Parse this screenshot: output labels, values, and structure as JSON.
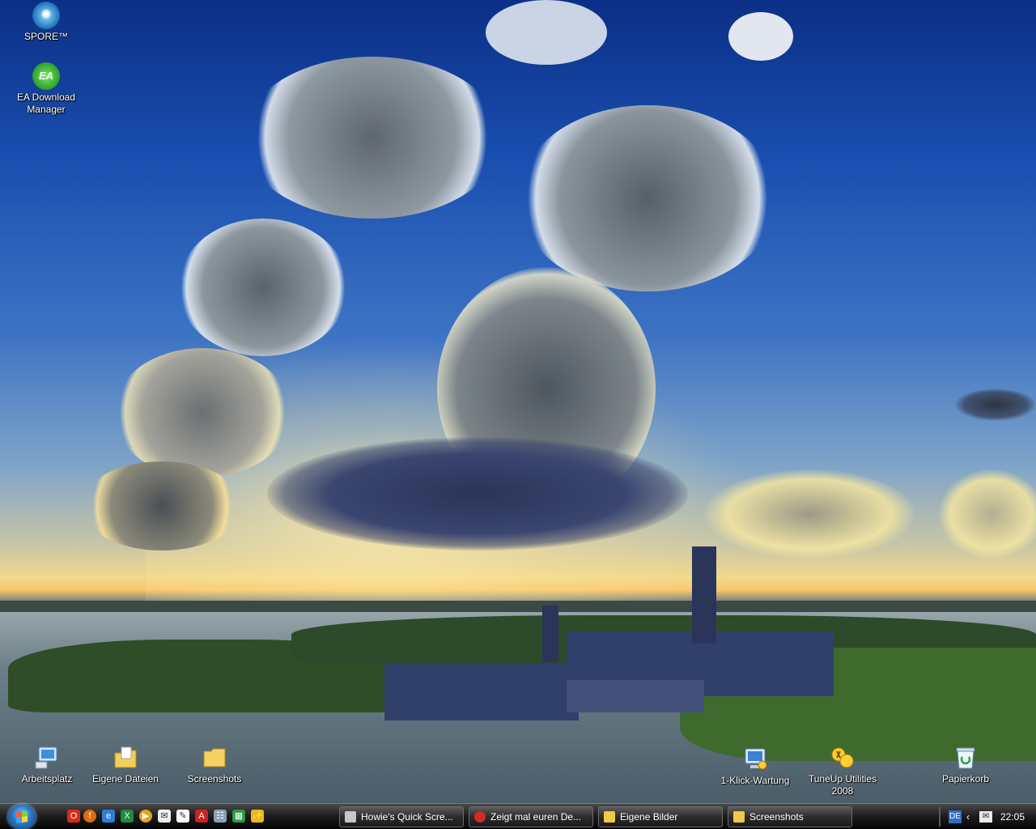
{
  "desktop": {
    "icons": [
      {
        "label": "SPORE™",
        "icon": "spore-icon"
      },
      {
        "label": "EA Download\nManager",
        "icon": "ea-icon"
      },
      {
        "label": "Arbeitsplatz",
        "icon": "computer-icon"
      },
      {
        "label": "Eigene Dateien",
        "icon": "documents-folder-icon"
      },
      {
        "label": "Screenshots",
        "icon": "folder-icon"
      },
      {
        "label": "1-Klick-Wartung",
        "icon": "maintenance-icon"
      },
      {
        "label": "TuneUp Utilities\n2008",
        "icon": "tuneup-icon"
      },
      {
        "label": "Papierkorb",
        "icon": "recycle-bin-icon"
      }
    ]
  },
  "taskbar": {
    "quick_launch": [
      "opera-icon",
      "firefox-icon",
      "internet-explorer-icon",
      "excel-icon",
      "media-player-icon",
      "outlook-icon",
      "mail-icon",
      "adobe-icon",
      "network-icon",
      "spreadsheet-icon",
      "tool-icon"
    ],
    "tasks": [
      {
        "label": "Howie's Quick Scre...",
        "icon": "screenshot-app-icon",
        "color": "#c8c8c8"
      },
      {
        "label": "Zeigt mal euren De...",
        "icon": "opera-icon",
        "color": "#d22b2b"
      },
      {
        "label": "Eigene Bilder",
        "icon": "folder-icon",
        "color": "#f0c84a"
      },
      {
        "label": "Screenshots",
        "icon": "folder-icon",
        "color": "#f0c84a"
      }
    ],
    "tray": {
      "language": "DE",
      "clock": "22:05"
    }
  }
}
